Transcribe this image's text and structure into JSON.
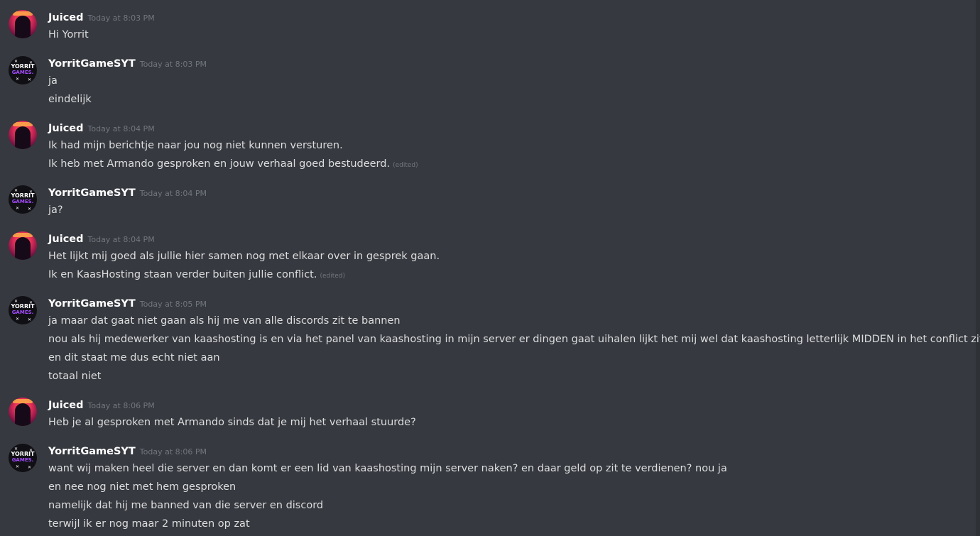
{
  "messages": [
    {
      "author": "Juiced",
      "timestamp": "Today at 8:03 PM",
      "avatar": "juiced-avatar",
      "lines": [
        {
          "text": "Hi Yorrit",
          "edited": ""
        }
      ]
    },
    {
      "author": "YorritGameSYT",
      "timestamp": "Today at 8:03 PM",
      "avatar": "yorrit-avatar",
      "lines": [
        {
          "text": "ja",
          "edited": ""
        },
        {
          "text": "eindelijk",
          "edited": ""
        }
      ]
    },
    {
      "author": "Juiced",
      "timestamp": "Today at 8:04 PM",
      "avatar": "juiced-avatar",
      "lines": [
        {
          "text": "Ik had mijn berichtje naar jou nog niet kunnen versturen.",
          "edited": ""
        },
        {
          "text": "Ik heb met Armando gesproken en jouw verhaal goed bestudeerd.",
          "edited": "(edited)"
        }
      ]
    },
    {
      "author": "YorritGameSYT",
      "timestamp": "Today at 8:04 PM",
      "avatar": "yorrit-avatar",
      "lines": [
        {
          "text": "ja?",
          "edited": ""
        }
      ]
    },
    {
      "author": "Juiced",
      "timestamp": "Today at 8:04 PM",
      "avatar": "juiced-avatar",
      "lines": [
        {
          "text": "Het lijkt mij goed als jullie hier samen nog met elkaar over in gesprek gaan.",
          "edited": ""
        },
        {
          "text": "Ik en KaasHosting staan verder buiten jullie conflict.",
          "edited": "(edited)"
        }
      ]
    },
    {
      "author": "YorritGameSYT",
      "timestamp": "Today at 8:05 PM",
      "avatar": "yorrit-avatar",
      "lines": [
        {
          "text": "ja maar dat gaat niet gaan als hij me van alle discords zit te bannen",
          "edited": ""
        },
        {
          "text": "nou als hij medewerker van kaashosting is en via het panel van kaashosting in mijn server er dingen gaat uihalen lijkt het mij wel dat kaashosting letterlijk MIDDEN in het conflict zit",
          "edited": ""
        },
        {
          "text": "en dit staat me dus echt niet aan",
          "edited": ""
        },
        {
          "text": "totaal niet",
          "edited": ""
        }
      ]
    },
    {
      "author": "Juiced",
      "timestamp": "Today at 8:06 PM",
      "avatar": "juiced-avatar",
      "lines": [
        {
          "text": "Heb je al gesproken met Armando sinds dat je mij het verhaal stuurde?",
          "edited": ""
        }
      ]
    },
    {
      "author": "YorritGameSYT",
      "timestamp": "Today at 8:06 PM",
      "avatar": "yorrit-avatar",
      "lines": [
        {
          "text": "want wij maken heel die server en dan komt er een lid van kaashosting mijn server naken? en daar geld op zit te verdienen? nou ja",
          "edited": ""
        },
        {
          "text": "en nee nog niet met hem gesproken",
          "edited": ""
        },
        {
          "text": "namelijk dat hij me banned van die server en discord",
          "edited": ""
        },
        {
          "text": "terwijl ik er nog maar 2 minuten op zat",
          "edited": ""
        }
      ]
    }
  ],
  "yorrit_avatar_text": {
    "line1": "YORRIT",
    "line2": "GAMES."
  },
  "colors": {
    "background": "#36393f",
    "username": "#ffffff",
    "timestamp": "#72767d",
    "message_text": "#dcddde",
    "accent_purple": "#a64cff"
  }
}
